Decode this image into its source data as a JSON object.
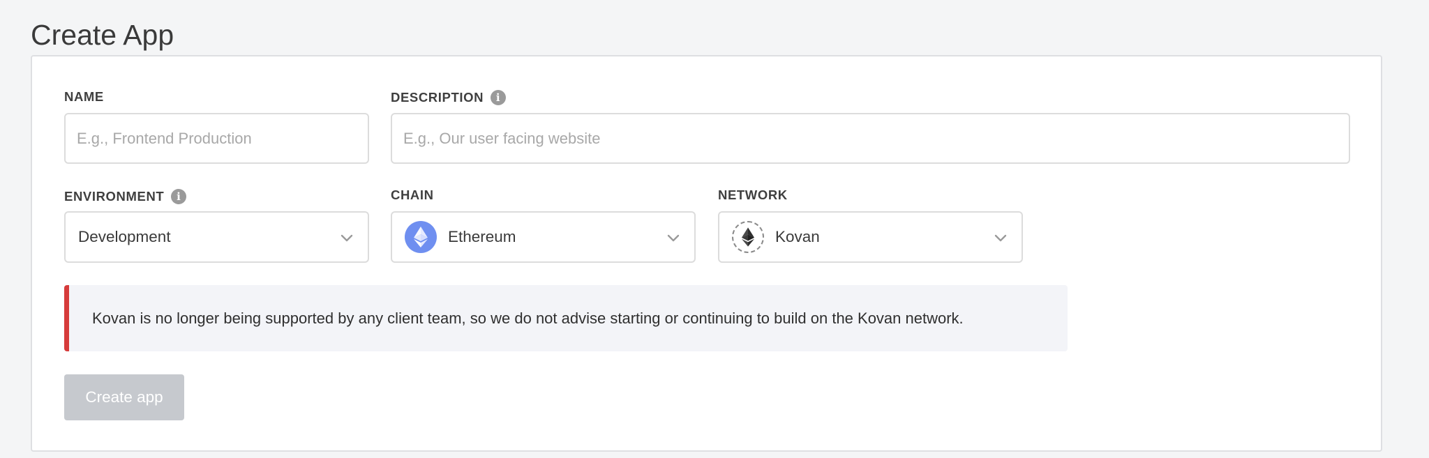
{
  "page": {
    "title": "Create App"
  },
  "form": {
    "name": {
      "label": "NAME",
      "placeholder": "E.g., Frontend Production",
      "value": ""
    },
    "description": {
      "label": "DESCRIPTION",
      "info_icon": "info-icon",
      "placeholder": "E.g., Our user facing website",
      "value": ""
    },
    "environment": {
      "label": "ENVIRONMENT",
      "info_icon": "info-icon",
      "selected": "Development",
      "icon": "chevron-down-icon"
    },
    "chain": {
      "label": "CHAIN",
      "selected": "Ethereum",
      "icon": "ethereum-icon",
      "icon_bg": "#6f8ff0"
    },
    "network": {
      "label": "NETWORK",
      "selected": "Kovan",
      "icon": "kovan-ethereum-icon"
    }
  },
  "alert": {
    "text": "Kovan is no longer being supported by any client team, so we do not advise starting or continuing to build on the Kovan network.",
    "accent": "#d63b3b"
  },
  "actions": {
    "create_label": "Create app",
    "create_disabled": true
  },
  "colors": {
    "page_bg": "#f4f5f6",
    "button_disabled_bg": "#c6c9ce",
    "ethereum_blue": "#6f8ff0"
  }
}
